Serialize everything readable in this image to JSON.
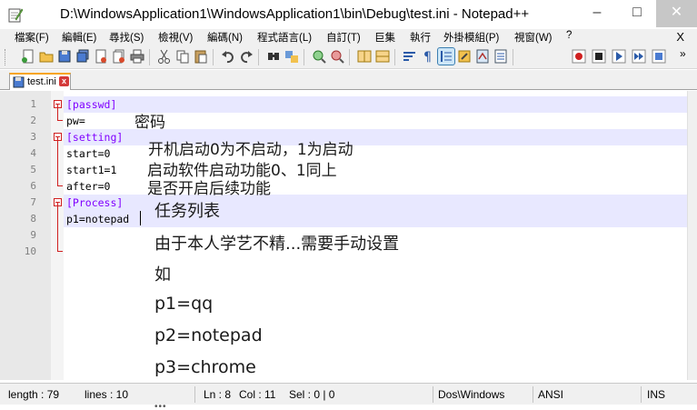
{
  "window": {
    "title": "D:\\WindowsApplication1\\WindowsApplication1\\bin\\Debug\\test.ini - Notepad++"
  },
  "menu": [
    {
      "label": "檔案(F)"
    },
    {
      "label": "編輯(E)"
    },
    {
      "label": "尋找(S)"
    },
    {
      "label": "檢視(V)"
    },
    {
      "label": "編碼(N)"
    },
    {
      "label": "程式語言(L)"
    },
    {
      "label": "自訂(T)"
    },
    {
      "label": "巨集"
    },
    {
      "label": "執行"
    },
    {
      "label": "外掛模組(P)"
    },
    {
      "label": "視窗(W)"
    },
    {
      "label": "?"
    }
  ],
  "menu_close": "X",
  "tab": {
    "label": "test.ini",
    "close": "x"
  },
  "lines": [
    {
      "num": "1",
      "text": "[passwd]"
    },
    {
      "num": "2",
      "text": "pw="
    },
    {
      "num": "3",
      "text": "[setting]"
    },
    {
      "num": "4",
      "text": "start=0"
    },
    {
      "num": "5",
      "text": "start1=1"
    },
    {
      "num": "6",
      "text": "after=0"
    },
    {
      "num": "7",
      "text": "[Process]"
    },
    {
      "num": "8",
      "text": "p1=notepad"
    },
    {
      "num": "9",
      "text": ""
    },
    {
      "num": "10",
      "text": ""
    }
  ],
  "annotations": [
    {
      "text": "密码"
    },
    {
      "text": "开机启动0为不启动，1为启动"
    },
    {
      "text": "启动软件启动功能0、1同上"
    },
    {
      "text": "是否开启后续功能"
    },
    {
      "text": "任务列表"
    },
    {
      "text": "由于本人学艺不精...需要手动设置"
    },
    {
      "text": "如"
    },
    {
      "text": "p1=qq"
    },
    {
      "text": "p2=notepad"
    },
    {
      "text": "p3=chrome"
    }
  ],
  "status": {
    "length": "length : 79",
    "lines": "lines : 10",
    "ln": "Ln : 8",
    "col": "Col : 11",
    "sel": "Sel : 0 | 0",
    "eol": "Dos\\Windows",
    "encoding": "ANSI",
    "mode": "INS"
  },
  "colors": {
    "section": "#8000ff",
    "current_line": "#e8e8ff",
    "fold_marker": "#d02020",
    "tab_accent": "#f7a51c"
  }
}
